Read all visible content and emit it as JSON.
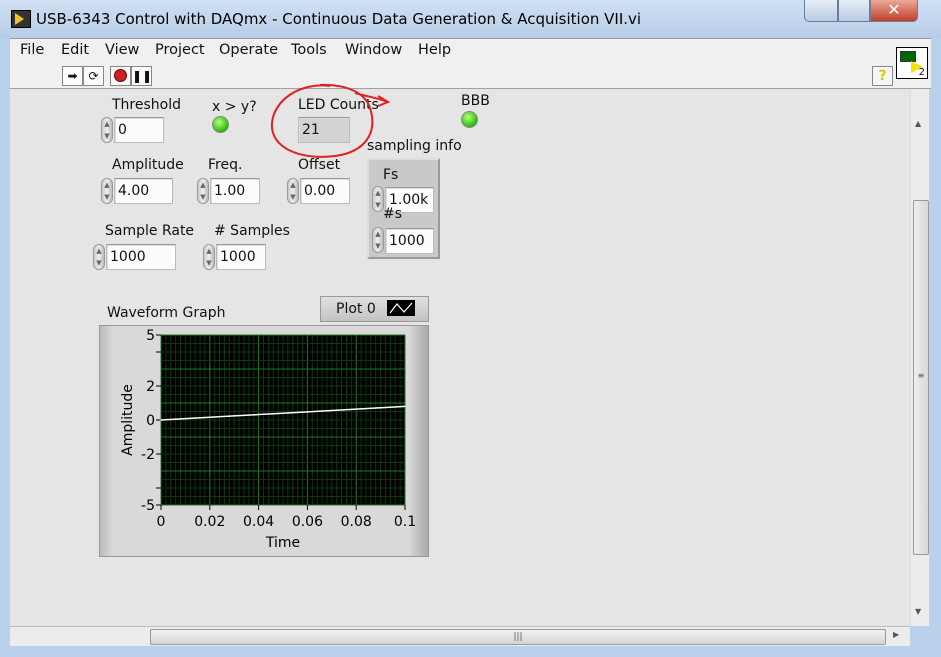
{
  "window": {
    "title": "USB-6343 Control with DAQmx - Continuous Data Generation & Acquisition VII.vi",
    "close_glyph": "✕",
    "icon_number": "2"
  },
  "menu": [
    "File",
    "Edit",
    "View",
    "Project",
    "Operate",
    "Tools",
    "Window",
    "Help"
  ],
  "toolbar": {
    "icons": [
      "run-continuously-icon",
      "run-icon",
      "abort-icon",
      "pause-icon"
    ],
    "help": "?"
  },
  "controls": {
    "threshold": {
      "label": "Threshold",
      "value": "0"
    },
    "comparison_led": {
      "label": "x > y?",
      "on": true
    },
    "led_counts": {
      "label": "LED Counts",
      "value": "21"
    },
    "bbb_led": {
      "label": "BBB",
      "on": true
    },
    "amplitude": {
      "label": "Amplitude",
      "value": "4.00"
    },
    "freq": {
      "label": "Freq.",
      "value": "1.00"
    },
    "offset": {
      "label": "Offset",
      "value": "0.00"
    },
    "sample_rate": {
      "label": "Sample Rate",
      "value": "1000"
    },
    "num_samples": {
      "label": "# Samples",
      "value": "1000"
    },
    "sampling_info": {
      "label": "sampling info",
      "fs_label": "Fs",
      "fs_value": "1.00k",
      "ns_label": "#s",
      "ns_value": "1000"
    }
  },
  "graph": {
    "label": "Waveform Graph",
    "legend": "Plot 0"
  },
  "annotation_color": "#e02020",
  "chart_data": {
    "type": "line",
    "xlabel": "Time",
    "ylabel": "Amplitude",
    "xlim": [
      0,
      0.1
    ],
    "ylim": [
      -5,
      5
    ],
    "xticks": [
      "0",
      "0.02",
      "0.04",
      "0.06",
      "0.08",
      "0.1"
    ],
    "yticks": [
      "5",
      "2",
      "0",
      "-2",
      "-5"
    ],
    "grid": true,
    "legend": "top-right",
    "series": [
      {
        "name": "Plot 0",
        "x": [
          0,
          0.01,
          0.02,
          0.03,
          0.04,
          0.05,
          0.06,
          0.07,
          0.08,
          0.09,
          0.1
        ],
        "y": [
          0,
          0.08,
          0.16,
          0.24,
          0.32,
          0.4,
          0.48,
          0.56,
          0.64,
          0.72,
          0.8
        ]
      }
    ]
  }
}
